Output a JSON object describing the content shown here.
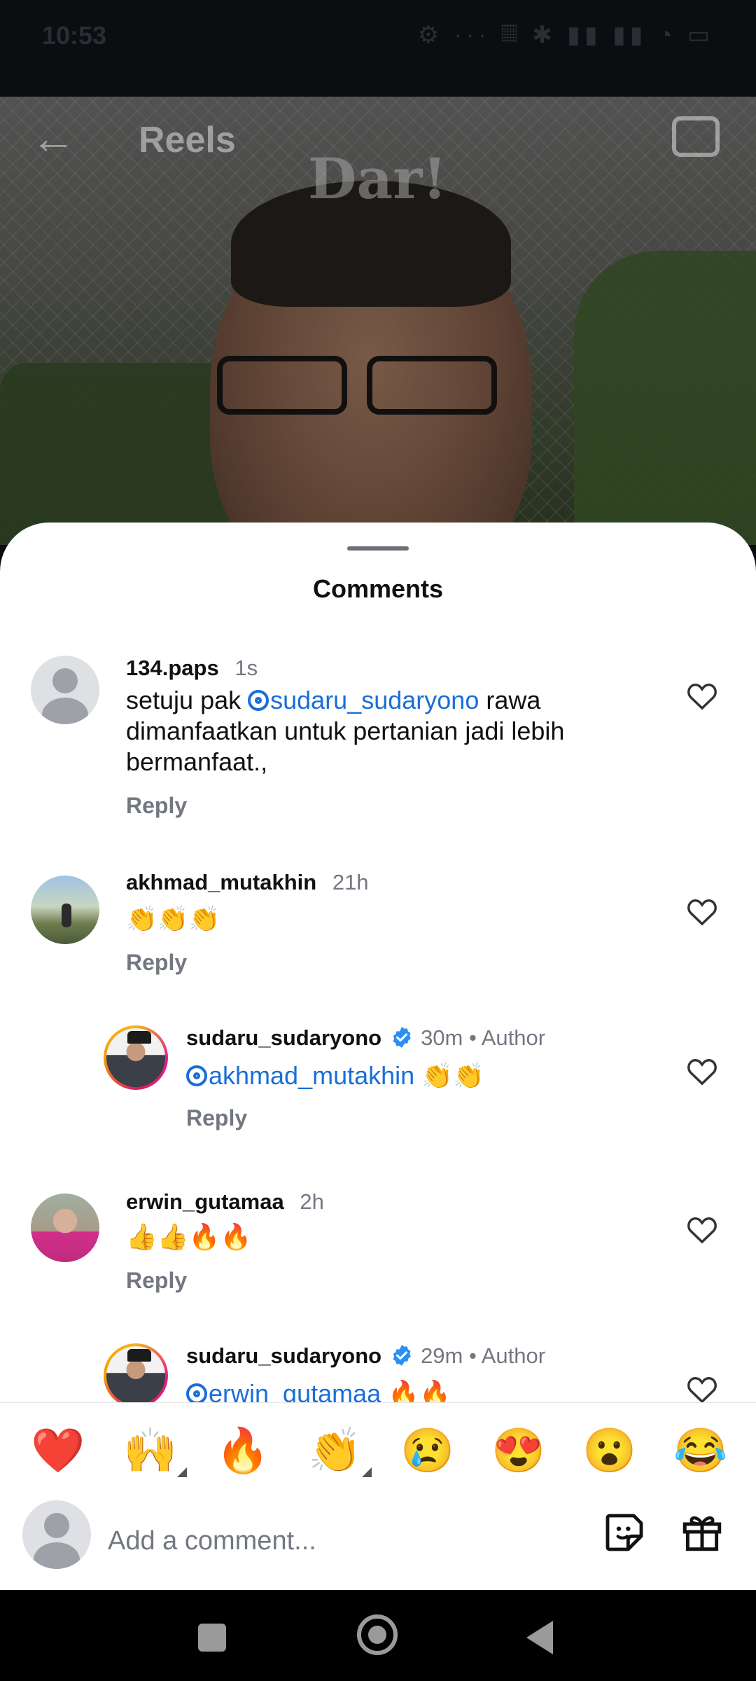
{
  "status_bar": {
    "time": "10:53",
    "icons": "⚙ ··· 𝄜 ✱ ▮▮ ▮▮ ◔ ▭"
  },
  "video": {
    "header_title": "Reels",
    "brand_text": "Dar!"
  },
  "sheet": {
    "title": "Comments"
  },
  "comments": [
    {
      "username": "134.paps",
      "time": "1s",
      "text_before": "setuju pak ",
      "mention": "sudaru_sudaryono",
      "text_after": " rawa dimanfaatkan untuk pertanian jadi lebih bermanfaat.,",
      "reply_label": "Reply",
      "avatar": "default-avatar"
    },
    {
      "username": "akhmad_mutakhin",
      "time": "21h",
      "text": "👏👏👏",
      "reply_label": "Reply",
      "avatar": "photo"
    },
    {
      "username": "sudaru_sudaryono",
      "verified": true,
      "time": "30m",
      "author_label": "Author",
      "mention": "akhmad_mutakhin",
      "text_after": " 👏👏",
      "reply_label": "Reply",
      "avatar": "photo"
    },
    {
      "username": "erwin_gutamaa",
      "time": "2h",
      "text": "👍👍🔥🔥",
      "reply_label": "Reply",
      "avatar": "photo"
    },
    {
      "username": "sudaru_sudaryono",
      "verified": true,
      "time": "29m",
      "author_label": "Author",
      "mention": "erwin_gutamaa",
      "text_after": " 🔥🔥",
      "avatar": "photo"
    }
  ],
  "emoji_bar": [
    "❤️",
    "🙌",
    "🔥",
    "👏",
    "😢",
    "😍",
    "😮",
    "😂"
  ],
  "input": {
    "placeholder": "Add a comment..."
  },
  "colors": {
    "mention": "#1a6ed8",
    "verified": "#2b8ff4",
    "secondary_text": "#737780"
  }
}
